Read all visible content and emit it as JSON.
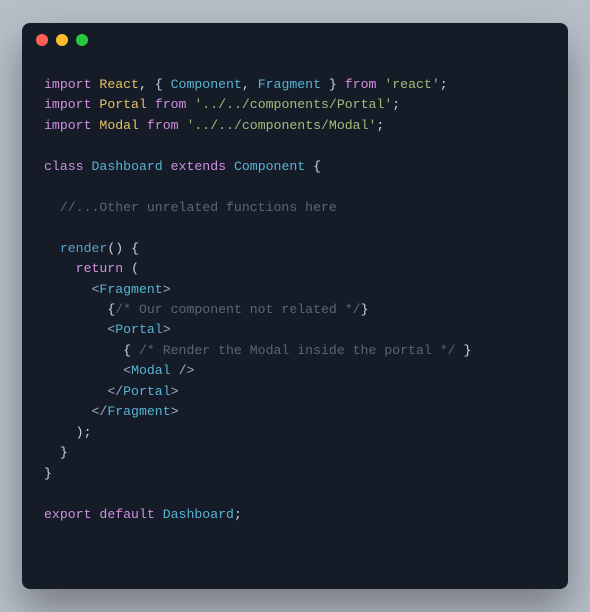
{
  "colors": {
    "bg": "#b7bec8",
    "editor": "#151c28",
    "keyword": "#d18fe0",
    "defName": "#e6c062",
    "className": "#58b4d4",
    "string": "#a0be77",
    "comment": "#5c6576"
  },
  "trafficLights": [
    "red",
    "yellow",
    "green"
  ],
  "code": {
    "lines": [
      [
        [
          "kw",
          "import"
        ],
        [
          "plain",
          " "
        ],
        [
          "def",
          "React"
        ],
        [
          "punc",
          ", "
        ],
        [
          "brace",
          "{ "
        ],
        [
          "cls",
          "Component"
        ],
        [
          "punc",
          ", "
        ],
        [
          "cls",
          "Fragment"
        ],
        [
          "brace",
          " }"
        ],
        [
          "plain",
          " "
        ],
        [
          "kw",
          "from"
        ],
        [
          "plain",
          " "
        ],
        [
          "str",
          "'react'"
        ],
        [
          "punc",
          ";"
        ]
      ],
      [
        [
          "kw",
          "import"
        ],
        [
          "plain",
          " "
        ],
        [
          "def",
          "Portal"
        ],
        [
          "plain",
          " "
        ],
        [
          "kw",
          "from"
        ],
        [
          "plain",
          " "
        ],
        [
          "str",
          "'../../components/Portal'"
        ],
        [
          "punc",
          ";"
        ]
      ],
      [
        [
          "kw",
          "import"
        ],
        [
          "plain",
          " "
        ],
        [
          "def",
          "Modal"
        ],
        [
          "plain",
          " "
        ],
        [
          "kw",
          "from"
        ],
        [
          "plain",
          " "
        ],
        [
          "str",
          "'../../components/Modal'"
        ],
        [
          "punc",
          ";"
        ]
      ],
      [],
      [
        [
          "kw",
          "class"
        ],
        [
          "plain",
          " "
        ],
        [
          "cls",
          "Dashboard"
        ],
        [
          "plain",
          " "
        ],
        [
          "kw",
          "extends"
        ],
        [
          "plain",
          " "
        ],
        [
          "cls",
          "Component"
        ],
        [
          "plain",
          " "
        ],
        [
          "brace",
          "{"
        ]
      ],
      [],
      [
        [
          "dim",
          "  //...Other unrelated functions here"
        ]
      ],
      [],
      [
        [
          "plain",
          "  "
        ],
        [
          "fn",
          "render"
        ],
        [
          "punc",
          "() "
        ],
        [
          "brace",
          "{"
        ]
      ],
      [
        [
          "plain",
          "    "
        ],
        [
          "kw",
          "return"
        ],
        [
          "plain",
          " "
        ],
        [
          "punc",
          "("
        ]
      ],
      [
        [
          "plain",
          "      "
        ],
        [
          "angle",
          "<"
        ],
        [
          "tag",
          "Fragment"
        ],
        [
          "angle",
          ">"
        ]
      ],
      [
        [
          "plain",
          "        "
        ],
        [
          "brace",
          "{"
        ],
        [
          "dim",
          "/* Our component not related */"
        ],
        [
          "brace",
          "}"
        ]
      ],
      [
        [
          "plain",
          "        "
        ],
        [
          "angle",
          "<"
        ],
        [
          "tag",
          "Portal"
        ],
        [
          "angle",
          ">"
        ]
      ],
      [
        [
          "plain",
          "          "
        ],
        [
          "brace",
          "{ "
        ],
        [
          "dim",
          "/* Render the Modal inside the portal */"
        ],
        [
          "brace",
          " }"
        ]
      ],
      [
        [
          "plain",
          "          "
        ],
        [
          "angle",
          "<"
        ],
        [
          "tag",
          "Modal"
        ],
        [
          "plain",
          " "
        ],
        [
          "angle",
          "/>"
        ]
      ],
      [
        [
          "plain",
          "        "
        ],
        [
          "angle",
          "</"
        ],
        [
          "tag",
          "Portal"
        ],
        [
          "angle",
          ">"
        ]
      ],
      [
        [
          "plain",
          "      "
        ],
        [
          "angle",
          "</"
        ],
        [
          "tag",
          "Fragment"
        ],
        [
          "angle",
          ">"
        ]
      ],
      [
        [
          "plain",
          "    "
        ],
        [
          "punc",
          ");"
        ]
      ],
      [
        [
          "plain",
          "  "
        ],
        [
          "brace",
          "}"
        ]
      ],
      [
        [
          "brace",
          "}"
        ]
      ],
      [],
      [
        [
          "kw",
          "export"
        ],
        [
          "plain",
          " "
        ],
        [
          "kw",
          "default"
        ],
        [
          "plain",
          " "
        ],
        [
          "cls",
          "Dashboard"
        ],
        [
          "punc",
          ";"
        ]
      ]
    ]
  }
}
